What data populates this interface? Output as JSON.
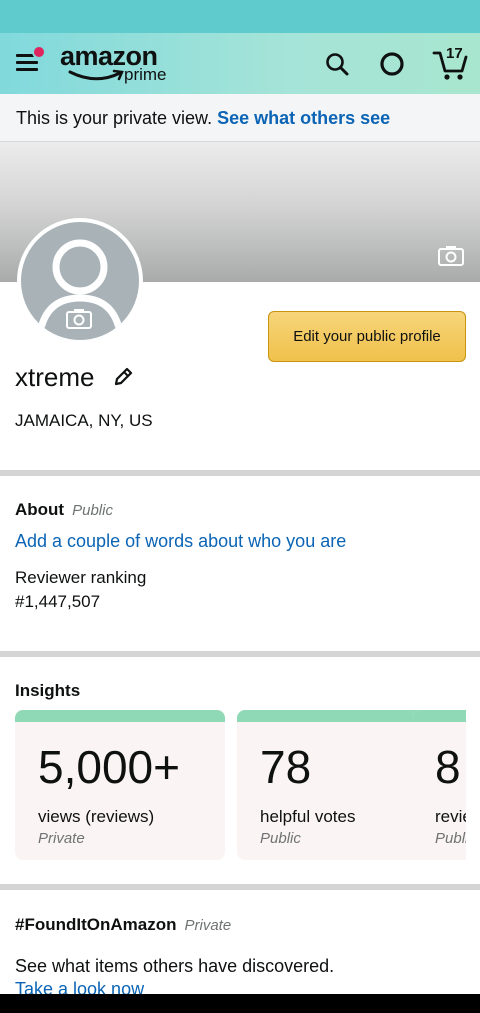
{
  "header": {
    "logo_text": "amazon",
    "logo_prime": "prime",
    "cart_count": "17",
    "icons": [
      "menu-icon",
      "search-icon",
      "alexa-icon",
      "cart-icon"
    ],
    "background": "#81d9dc"
  },
  "private_bar": {
    "text": "This is your private view.",
    "link": "See what others see"
  },
  "profile": {
    "edit_button": "Edit your public profile",
    "name": "xtreme",
    "location": "JAMAICA, NY, US"
  },
  "about": {
    "title": "About",
    "visibility": "Public",
    "link": "Add a couple of words about who you are",
    "ranking_label": "Reviewer ranking",
    "ranking_value": "#1,447,507"
  },
  "insights": {
    "title": "Insights",
    "cards": [
      {
        "value": "5,000+",
        "label": "views (reviews)",
        "visibility": "Private"
      },
      {
        "value": "78",
        "label": "helpful votes",
        "visibility": "Public"
      },
      {
        "value": "8",
        "label": "reviews",
        "visibility": "Public"
      }
    ]
  },
  "found": {
    "title": "#FoundItOnAmazon",
    "visibility": "Private",
    "text": "See what items others have discovered.",
    "link": "Take a look now"
  },
  "colors": {
    "link": "#0b64b5",
    "button": "#f0c14b",
    "card_accent": "#8fd9b6"
  }
}
